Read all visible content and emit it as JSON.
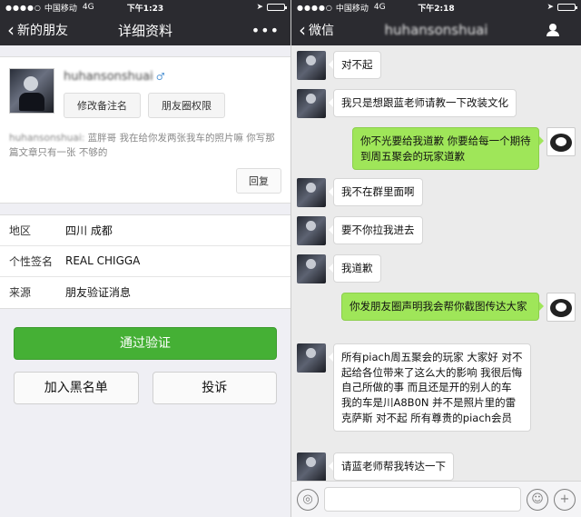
{
  "left": {
    "status": {
      "signal": "●●●●○",
      "carrier": "中国移动",
      "network": "4G",
      "time": "下午1:23",
      "location_glyph": "➤",
      "battery_level": 0.9
    },
    "nav": {
      "back_label": "新的朋友",
      "title": "详细资料",
      "more": "•••"
    },
    "profile": {
      "nickname": "huhansonshuai",
      "gender_glyph": "♂",
      "remark_button": "修改备注名",
      "moments_button": "朋友圈权限",
      "message_sender": "huhansonshuai:",
      "message_text": "蓝胖哥 我在给你发两张我车的照片嘛 你写那篇文章只有一张 不够的",
      "reply_button": "回复"
    },
    "info": [
      {
        "label": "地区",
        "value": "四川 成都"
      },
      {
        "label": "个性签名",
        "value": "REAL CHIGGA"
      },
      {
        "label": "来源",
        "value": "朋友验证消息"
      }
    ],
    "actions": {
      "verify": "通过验证",
      "blacklist": "加入黑名单",
      "report": "投诉"
    }
  },
  "right": {
    "status": {
      "signal": "●●●●○",
      "carrier": "中国移动",
      "network": "4G",
      "time": "下午2:18",
      "location_glyph": "➤",
      "battery_level": 0.9
    },
    "nav": {
      "back_label": "微信",
      "title": "huhansonshuai"
    },
    "messages": [
      {
        "from": "him",
        "text": "对不起"
      },
      {
        "from": "him",
        "text": "我只是想跟蓝老师请教一下改装文化"
      },
      {
        "from": "me",
        "text": "你不光要给我道歉 你要给每一个期待到周五聚会的玩家道歉"
      },
      {
        "from": "him",
        "text": "我不在群里面啊"
      },
      {
        "from": "him",
        "text": "要不你拉我进去"
      },
      {
        "from": "him",
        "text": "我道歉"
      },
      {
        "from": "me",
        "text": "你发朋友圈声明我会帮你截图传达大家"
      },
      {
        "from": "him",
        "text": "所有piach周五聚会的玩家 大家好 对不起给各位带来了这么大的影响 我很后悔自己所做的事 而且还是开的别人的车 我的车是川A8B0N 并不是照片里的雷克萨斯 对不起 所有尊贵的piach会员"
      },
      {
        "from": "him",
        "text": "请蓝老师帮我转达一下"
      }
    ],
    "input": {
      "voice_glyph": "◎",
      "emoji_glyph": "☺",
      "plus_glyph": "+"
    }
  }
}
